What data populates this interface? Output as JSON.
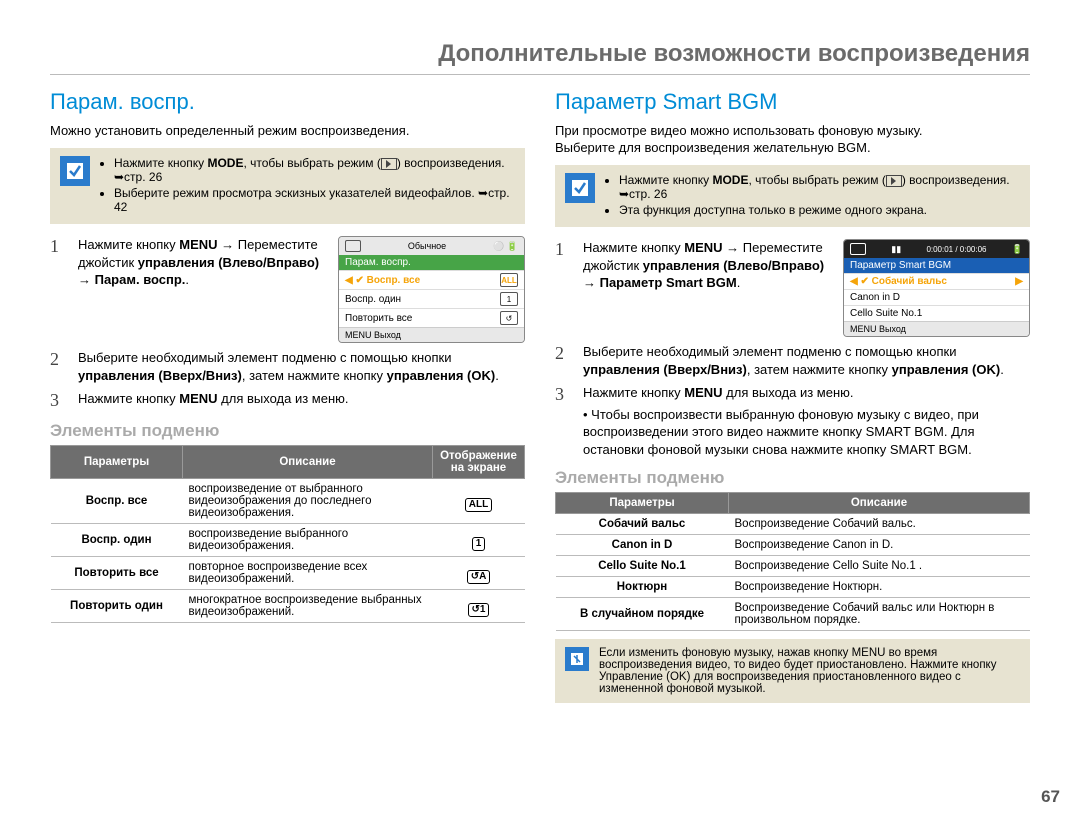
{
  "header": {
    "title": "Дополнительные возможности воспроизведения"
  },
  "page_number": "67",
  "left": {
    "heading": "Парам. воспр.",
    "intro": "Можно установить определенный режим воспроизведения.",
    "note": {
      "l1a": "Нажмите кнопку ",
      "l1_mode": "MODE",
      "l1b": ", чтобы выбрать режим (",
      "l1c": ") воспроизведения. ",
      "l1_ref": "➥стр. 26",
      "l2": "Выберите режим просмотра эскизных указателей видеофайлов. ➥стр. 42"
    },
    "steps": {
      "s1": {
        "a": "Нажмите кнопку ",
        "menu": "MENU",
        "b": " → Переместите джойстик ",
        "c": "управления (Влево/Вправо)",
        "d": " → Парам. воспр."
      },
      "s2": {
        "a": "Выберите необходимый элемент подменю с помощью кнопки ",
        "b": "управления (Вверх/Вниз)",
        "c": ", затем нажмите кнопку ",
        "d": "управления (OK)",
        "e": "."
      },
      "s3": {
        "a": "Нажмите кнопку ",
        "menu": "MENU",
        "b": " для выхода из меню."
      }
    },
    "screenshot": {
      "top_label": "Обычное",
      "menu_title": "Парам. воспр.",
      "rows": [
        {
          "label": "Воспр. все",
          "icon": "ALL"
        },
        {
          "label": "Воспр. один",
          "icon": "1"
        },
        {
          "label": "Повторить все",
          "icon": "↺"
        }
      ],
      "exit": "MENU Выход"
    },
    "sub_heading": "Элементы подменю",
    "table": {
      "h1": "Параметры",
      "h2": "Описание",
      "h3": "Отображение на экране",
      "rows": [
        {
          "param": "Воспр. все",
          "desc": "воспроизведение от выбранного видеоизображения до последнего видеоизображения.",
          "icon": "ALL"
        },
        {
          "param": "Воспр. один",
          "desc": "воспроизведение выбранного видеоизображения.",
          "icon": "1"
        },
        {
          "param": "Повторить все",
          "desc": "повторное воспроизведение всех видеоизображений.",
          "icon": "↺A"
        },
        {
          "param": "Повторить один",
          "desc": "многократное воспроизведение выбранных видеоизображений.",
          "icon": "↺1"
        }
      ]
    }
  },
  "right": {
    "heading": "Параметр Smart BGM",
    "intro1": "При просмотре видео можно использовать фоновую музыку.",
    "intro2": "Выберите для воспроизведения желательную BGM.",
    "note": {
      "l1a": "Нажмите кнопку ",
      "l1_mode": "MODE",
      "l1b": ", чтобы выбрать режим (",
      "l1c": ") воспроизведения. ",
      "l1_ref": "➥стр. 26",
      "l2": "Эта функция доступна только в режиме одного экрана."
    },
    "steps": {
      "s1": {
        "a": "Нажмите кнопку ",
        "menu": "MENU",
        "b": " → Переместите джойстик ",
        "c": "управления (Влево/Вправо)",
        "d": " → Параметр Smart BGM",
        "e": "."
      },
      "s2": {
        "a": "Выберите необходимый элемент подменю с помощью кнопки ",
        "b": "управления (Вверх/Вниз)",
        "c": ", затем нажмите кнопку ",
        "d": "управления (OK)",
        "e": "."
      },
      "s3": {
        "a": "Нажмите кнопку ",
        "menu": "MENU",
        "b": " для выхода из меню."
      },
      "s3_sub": "Чтобы воспроизвести выбранную фоновую музыку с видео, при воспроизведении этого видео нажмите кнопку SMART BGM. Для остановки фоновой музыки снова нажмите кнопку SMART BGM."
    },
    "screenshot": {
      "time": "0:00:01 / 0:00:06",
      "menu_title": "Параметр Smart BGM",
      "rows": [
        {
          "label": "Собачий вальс",
          "selected": true
        },
        {
          "label": "Canon in D",
          "selected": false
        },
        {
          "label": "Cello Suite No.1",
          "selected": false
        }
      ],
      "exit": "MENU Выход"
    },
    "sub_heading": "Элементы подменю",
    "table": {
      "h1": "Параметры",
      "h2": "Описание",
      "rows": [
        {
          "param": "Собачий вальс",
          "desc": "Воспроизведение Собачий вальс."
        },
        {
          "param": "Canon in D",
          "desc": "Воспроизведение Canon in D."
        },
        {
          "param": "Cello Suite No.1",
          "desc": "Воспроизведение Cello Suite No.1 ."
        },
        {
          "param": "Ноктюрн",
          "desc": "Воспроизведение Ноктюрн."
        },
        {
          "param": "В случайном порядке",
          "desc": "Воспроизведение Собачий вальс или Ноктюрн в произвольном порядке."
        }
      ]
    },
    "footnote": "Если изменить фоновую музыку, нажав кнопку MENU во время воспроизведения видео, то видео будет приостановлено. Нажмите кнопку Управление (OK) для воспроизведения приостановленного видео с измененной фоновой музыкой."
  }
}
